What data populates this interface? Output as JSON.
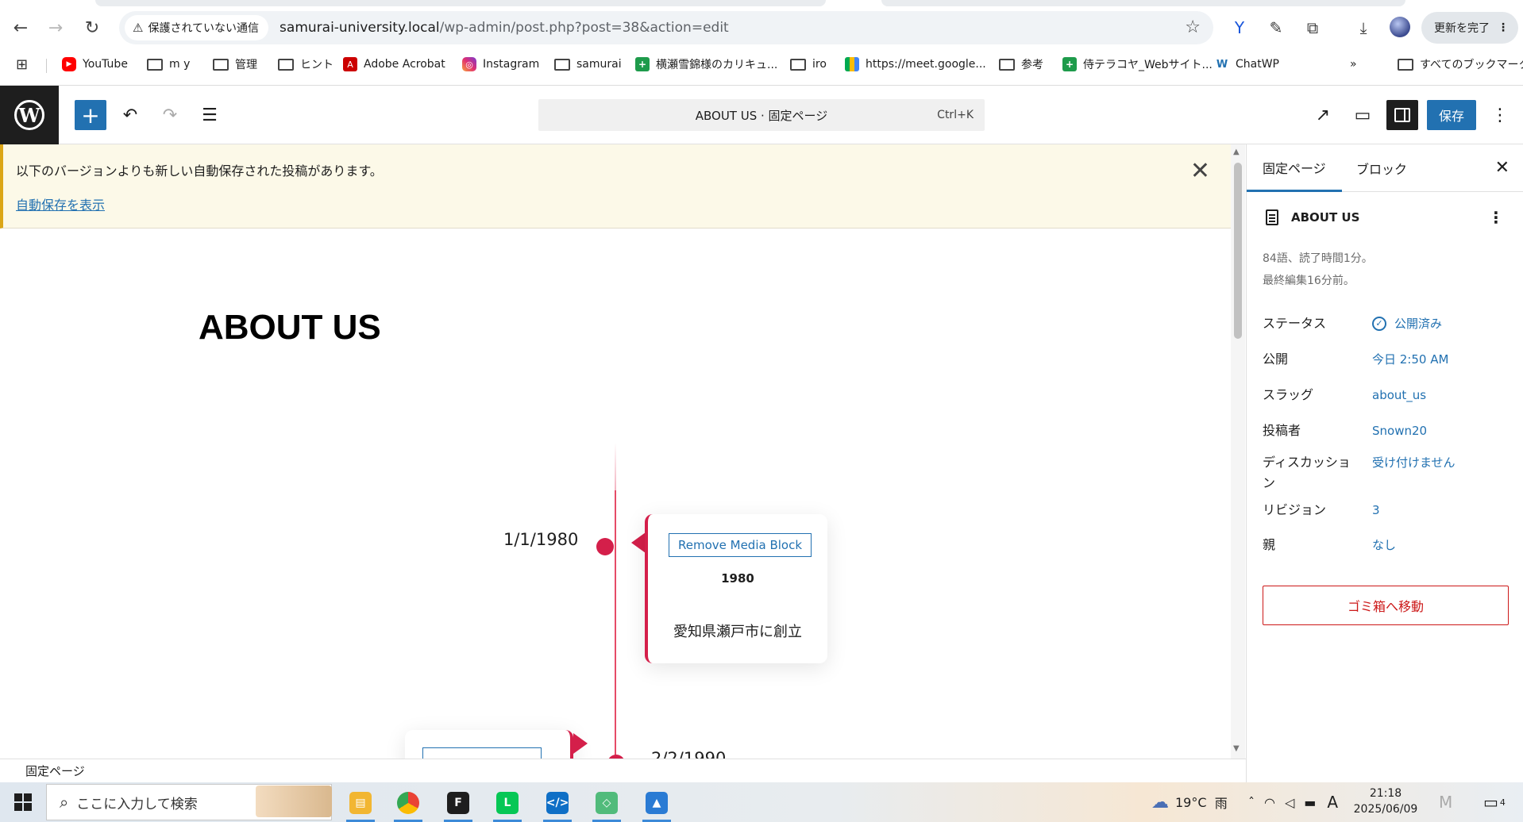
{
  "browser": {
    "security_label": "保護されていない通信",
    "url_host": "samurai-university.local",
    "url_path": "/wp-admin/post.php?post=38&action=edit",
    "update_label": "更新を完了"
  },
  "bookmarks": [
    {
      "label": "YouTube",
      "icon": "youtube"
    },
    {
      "label": "m y",
      "icon": "folder"
    },
    {
      "label": "管理",
      "icon": "folder"
    },
    {
      "label": "ヒント",
      "icon": "folder"
    },
    {
      "label": "Adobe Acrobat",
      "icon": "adobe"
    },
    {
      "label": "Instagram",
      "icon": "instagram"
    },
    {
      "label": "samurai",
      "icon": "folder"
    },
    {
      "label": "横瀬雪錦様のカリキュ...",
      "icon": "sheets"
    },
    {
      "label": "iro",
      "icon": "folder"
    },
    {
      "label": "https://meet.google...",
      "icon": "meet"
    },
    {
      "label": "参考",
      "icon": "folder"
    },
    {
      "label": "侍テラコヤ_Webサイト...",
      "icon": "sheets"
    },
    {
      "label": "ChatWP",
      "icon": "wp"
    }
  ],
  "bookmarks_all": "すべてのブックマーク",
  "editor": {
    "command_bar": "ABOUT US · 固定ページ",
    "command_shortcut": "Ctrl+K",
    "save_label": "保存"
  },
  "notice": {
    "message": "以下のバージョンよりも新しい自動保存された投稿があります。",
    "link": "自動保存を表示"
  },
  "canvas": {
    "title": "ABOUT US",
    "timeline": [
      {
        "date": "1/1/1980",
        "button": "Remove Media Block",
        "year": "1980",
        "text": "愛知県瀬戸市に創立"
      },
      {
        "date": "2/2/1990"
      }
    ]
  },
  "status_bar": "固定ページ",
  "sidebar": {
    "tab_page": "固定ページ",
    "tab_block": "ブロック",
    "doc_title": "ABOUT US",
    "meta_line1": "84語、読了時間1分。",
    "meta_line2": "最終編集16分前。",
    "rows": [
      {
        "key": "ステータス",
        "value": "公開済み"
      },
      {
        "key": "公開",
        "value": "今日 2:50 AM"
      },
      {
        "key": "スラッグ",
        "value": "about_us"
      },
      {
        "key": "投稿者",
        "value": "Snown20"
      },
      {
        "key": "ディスカッション",
        "value": "受け付けません"
      },
      {
        "key": "リビジョン",
        "value": "3"
      },
      {
        "key": "親",
        "value": "なし"
      }
    ],
    "trash_label": "ゴミ箱へ移動"
  },
  "taskbar": {
    "search_placeholder": "ここに入力して検索",
    "weather": "19°C",
    "weather_cond": "雨",
    "ime": "A",
    "time": "21:18",
    "date": "2025/06/09",
    "notification_count": "4"
  },
  "colors": {
    "wp_blue": "#2271b1",
    "timeline_red": "#d41f4a",
    "notice_bg": "#fcf9e8"
  }
}
